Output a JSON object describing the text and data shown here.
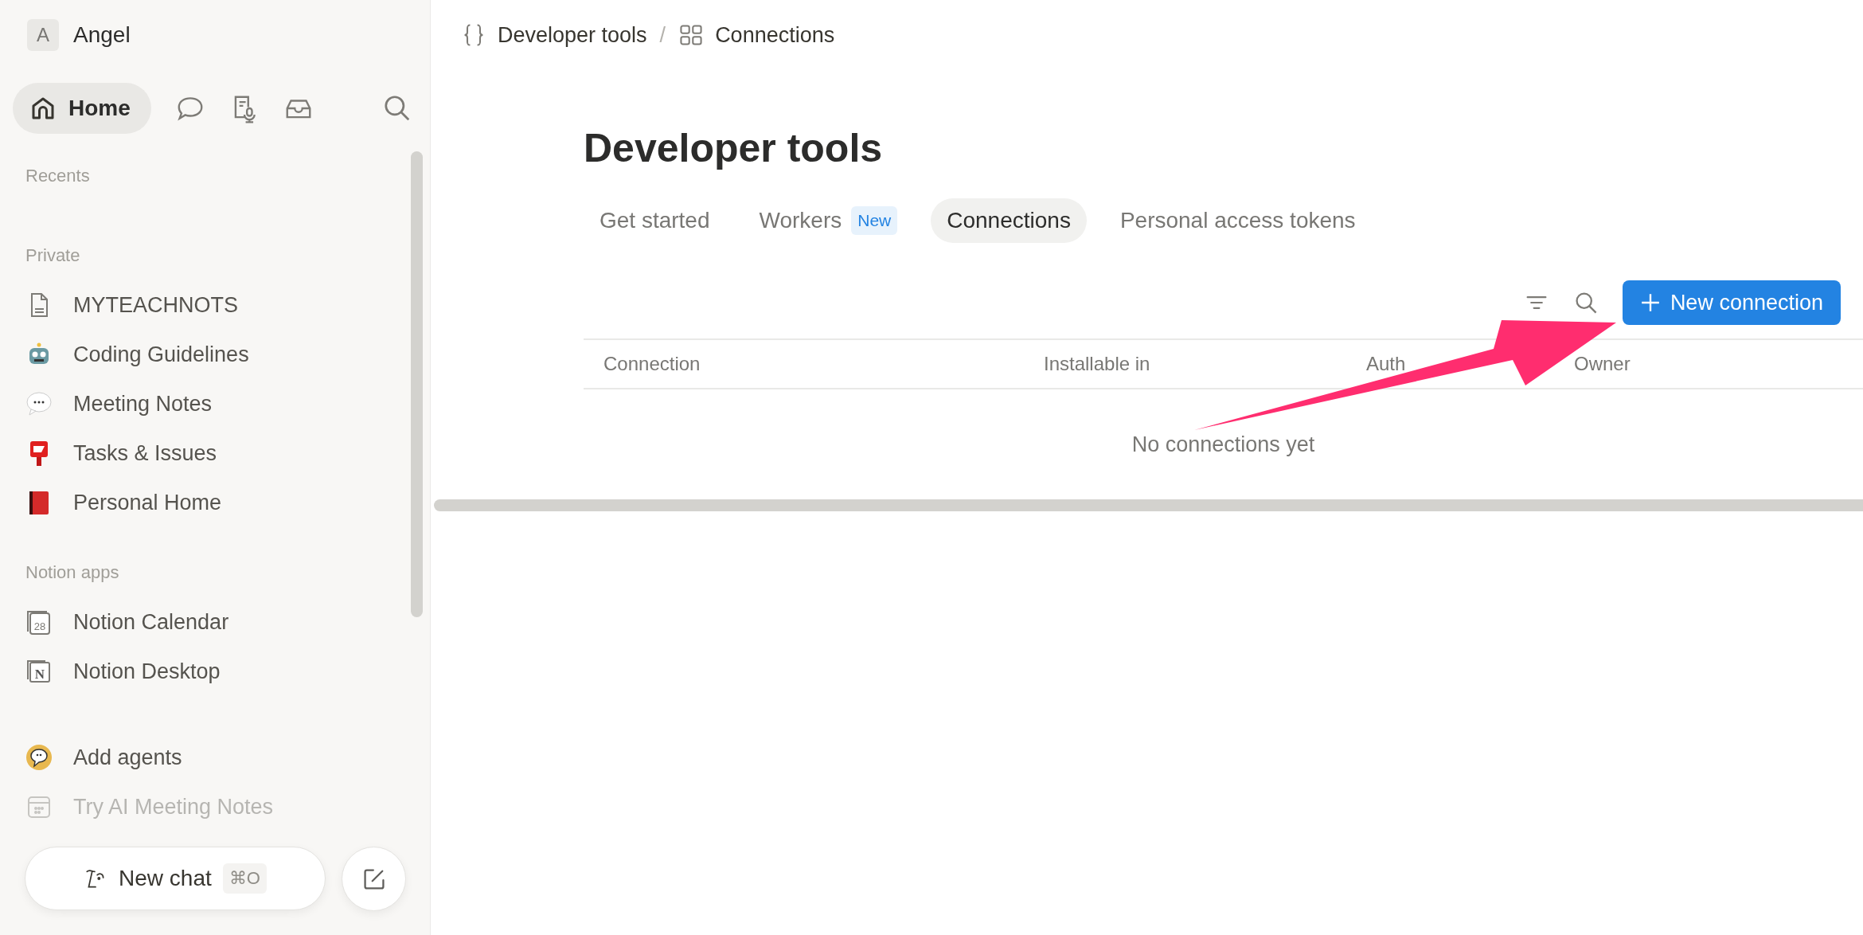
{
  "sidebar": {
    "workspace": {
      "initial": "A",
      "name": "Angel"
    },
    "home": {
      "label": "Home",
      "selected": true
    },
    "nav_icons": [
      {
        "kind": "chat"
      },
      {
        "kind": "transcribe"
      },
      {
        "kind": "inbox"
      },
      {
        "kind": "search"
      }
    ],
    "sections": [
      {
        "heading": "Recents"
      },
      {
        "heading": "Private",
        "items": [
          {
            "kind": "doc",
            "label": "MYTEACHNOTS"
          },
          {
            "kind": "robot",
            "label": "Coding Guidelines"
          },
          {
            "kind": "speech",
            "label": "Meeting Notes"
          },
          {
            "kind": "postbox",
            "label": "Tasks & Issues"
          },
          {
            "kind": "book",
            "label": "Personal Home"
          }
        ]
      },
      {
        "heading": "Notion apps",
        "items": [
          {
            "kind": "calendar",
            "icon_text": "28",
            "label": "Notion Calendar"
          },
          {
            "kind": "notion",
            "icon_text": "N",
            "label": "Notion Desktop"
          }
        ]
      }
    ],
    "extras": [
      {
        "kind": "agent",
        "label": "Add agents",
        "dimmed": false
      },
      {
        "kind": "meeting",
        "label": "Try AI Meeting Notes",
        "dimmed": true
      }
    ],
    "new_chat": {
      "label": "New chat",
      "shortcut": "⌘O"
    }
  },
  "main": {
    "breadcrumb": [
      {
        "kind": "braces",
        "label": "Developer tools"
      },
      {
        "kind": "grid",
        "label": "Connections"
      }
    ],
    "separator": "/",
    "title": "Developer tools",
    "tabs": [
      {
        "label": "Get started",
        "selected": false
      },
      {
        "label": "Workers",
        "badge": "New",
        "selected": false
      },
      {
        "label": "Connections",
        "selected": true
      },
      {
        "label": "Personal access tokens",
        "selected": false
      }
    ],
    "primary_button": "New connection",
    "table": {
      "columns": [
        "Connection",
        "Installable in",
        "Auth",
        "Owner"
      ],
      "empty_text": "No connections yet"
    },
    "callout_arrow": true
  }
}
